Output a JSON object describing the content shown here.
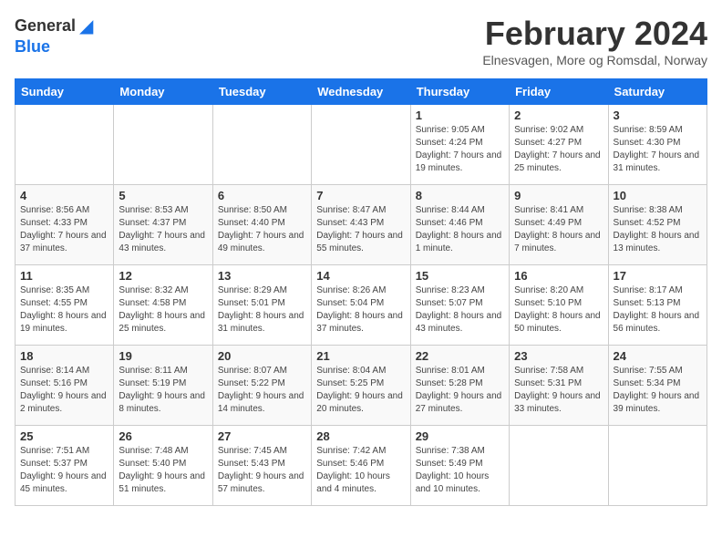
{
  "logo": {
    "general": "General",
    "blue": "Blue"
  },
  "title": {
    "month_year": "February 2024",
    "location": "Elnesvagen, More og Romsdal, Norway"
  },
  "headers": [
    "Sunday",
    "Monday",
    "Tuesday",
    "Wednesday",
    "Thursday",
    "Friday",
    "Saturday"
  ],
  "weeks": [
    [
      {
        "day": "",
        "sunrise": "",
        "sunset": "",
        "daylight": ""
      },
      {
        "day": "",
        "sunrise": "",
        "sunset": "",
        "daylight": ""
      },
      {
        "day": "",
        "sunrise": "",
        "sunset": "",
        "daylight": ""
      },
      {
        "day": "",
        "sunrise": "",
        "sunset": "",
        "daylight": ""
      },
      {
        "day": "1",
        "sunrise": "Sunrise: 9:05 AM",
        "sunset": "Sunset: 4:24 PM",
        "daylight": "Daylight: 7 hours and 19 minutes."
      },
      {
        "day": "2",
        "sunrise": "Sunrise: 9:02 AM",
        "sunset": "Sunset: 4:27 PM",
        "daylight": "Daylight: 7 hours and 25 minutes."
      },
      {
        "day": "3",
        "sunrise": "Sunrise: 8:59 AM",
        "sunset": "Sunset: 4:30 PM",
        "daylight": "Daylight: 7 hours and 31 minutes."
      }
    ],
    [
      {
        "day": "4",
        "sunrise": "Sunrise: 8:56 AM",
        "sunset": "Sunset: 4:33 PM",
        "daylight": "Daylight: 7 hours and 37 minutes."
      },
      {
        "day": "5",
        "sunrise": "Sunrise: 8:53 AM",
        "sunset": "Sunset: 4:37 PM",
        "daylight": "Daylight: 7 hours and 43 minutes."
      },
      {
        "day": "6",
        "sunrise": "Sunrise: 8:50 AM",
        "sunset": "Sunset: 4:40 PM",
        "daylight": "Daylight: 7 hours and 49 minutes."
      },
      {
        "day": "7",
        "sunrise": "Sunrise: 8:47 AM",
        "sunset": "Sunset: 4:43 PM",
        "daylight": "Daylight: 7 hours and 55 minutes."
      },
      {
        "day": "8",
        "sunrise": "Sunrise: 8:44 AM",
        "sunset": "Sunset: 4:46 PM",
        "daylight": "Daylight: 8 hours and 1 minute."
      },
      {
        "day": "9",
        "sunrise": "Sunrise: 8:41 AM",
        "sunset": "Sunset: 4:49 PM",
        "daylight": "Daylight: 8 hours and 7 minutes."
      },
      {
        "day": "10",
        "sunrise": "Sunrise: 8:38 AM",
        "sunset": "Sunset: 4:52 PM",
        "daylight": "Daylight: 8 hours and 13 minutes."
      }
    ],
    [
      {
        "day": "11",
        "sunrise": "Sunrise: 8:35 AM",
        "sunset": "Sunset: 4:55 PM",
        "daylight": "Daylight: 8 hours and 19 minutes."
      },
      {
        "day": "12",
        "sunrise": "Sunrise: 8:32 AM",
        "sunset": "Sunset: 4:58 PM",
        "daylight": "Daylight: 8 hours and 25 minutes."
      },
      {
        "day": "13",
        "sunrise": "Sunrise: 8:29 AM",
        "sunset": "Sunset: 5:01 PM",
        "daylight": "Daylight: 8 hours and 31 minutes."
      },
      {
        "day": "14",
        "sunrise": "Sunrise: 8:26 AM",
        "sunset": "Sunset: 5:04 PM",
        "daylight": "Daylight: 8 hours and 37 minutes."
      },
      {
        "day": "15",
        "sunrise": "Sunrise: 8:23 AM",
        "sunset": "Sunset: 5:07 PM",
        "daylight": "Daylight: 8 hours and 43 minutes."
      },
      {
        "day": "16",
        "sunrise": "Sunrise: 8:20 AM",
        "sunset": "Sunset: 5:10 PM",
        "daylight": "Daylight: 8 hours and 50 minutes."
      },
      {
        "day": "17",
        "sunrise": "Sunrise: 8:17 AM",
        "sunset": "Sunset: 5:13 PM",
        "daylight": "Daylight: 8 hours and 56 minutes."
      }
    ],
    [
      {
        "day": "18",
        "sunrise": "Sunrise: 8:14 AM",
        "sunset": "Sunset: 5:16 PM",
        "daylight": "Daylight: 9 hours and 2 minutes."
      },
      {
        "day": "19",
        "sunrise": "Sunrise: 8:11 AM",
        "sunset": "Sunset: 5:19 PM",
        "daylight": "Daylight: 9 hours and 8 minutes."
      },
      {
        "day": "20",
        "sunrise": "Sunrise: 8:07 AM",
        "sunset": "Sunset: 5:22 PM",
        "daylight": "Daylight: 9 hours and 14 minutes."
      },
      {
        "day": "21",
        "sunrise": "Sunrise: 8:04 AM",
        "sunset": "Sunset: 5:25 PM",
        "daylight": "Daylight: 9 hours and 20 minutes."
      },
      {
        "day": "22",
        "sunrise": "Sunrise: 8:01 AM",
        "sunset": "Sunset: 5:28 PM",
        "daylight": "Daylight: 9 hours and 27 minutes."
      },
      {
        "day": "23",
        "sunrise": "Sunrise: 7:58 AM",
        "sunset": "Sunset: 5:31 PM",
        "daylight": "Daylight: 9 hours and 33 minutes."
      },
      {
        "day": "24",
        "sunrise": "Sunrise: 7:55 AM",
        "sunset": "Sunset: 5:34 PM",
        "daylight": "Daylight: 9 hours and 39 minutes."
      }
    ],
    [
      {
        "day": "25",
        "sunrise": "Sunrise: 7:51 AM",
        "sunset": "Sunset: 5:37 PM",
        "daylight": "Daylight: 9 hours and 45 minutes."
      },
      {
        "day": "26",
        "sunrise": "Sunrise: 7:48 AM",
        "sunset": "Sunset: 5:40 PM",
        "daylight": "Daylight: 9 hours and 51 minutes."
      },
      {
        "day": "27",
        "sunrise": "Sunrise: 7:45 AM",
        "sunset": "Sunset: 5:43 PM",
        "daylight": "Daylight: 9 hours and 57 minutes."
      },
      {
        "day": "28",
        "sunrise": "Sunrise: 7:42 AM",
        "sunset": "Sunset: 5:46 PM",
        "daylight": "Daylight: 10 hours and 4 minutes."
      },
      {
        "day": "29",
        "sunrise": "Sunrise: 7:38 AM",
        "sunset": "Sunset: 5:49 PM",
        "daylight": "Daylight: 10 hours and 10 minutes."
      },
      {
        "day": "",
        "sunrise": "",
        "sunset": "",
        "daylight": ""
      },
      {
        "day": "",
        "sunrise": "",
        "sunset": "",
        "daylight": ""
      }
    ]
  ]
}
